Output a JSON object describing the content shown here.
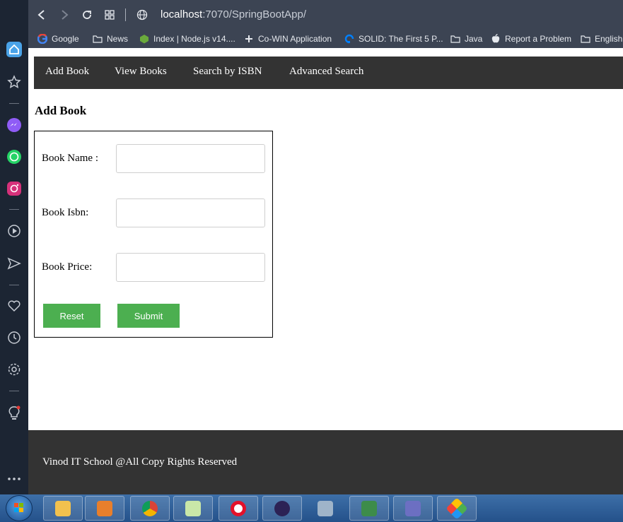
{
  "browser": {
    "url_host": "localhost",
    "url_rest": ":7070/SpringBootApp/",
    "bookmarks": [
      {
        "label": "Google",
        "icon": "google-icon"
      },
      {
        "label": "News",
        "icon": "folder-icon"
      },
      {
        "label": "Index | Node.js v14....",
        "icon": "nodejs-icon"
      },
      {
        "label": "Co-WIN Application",
        "icon": "cowin-icon"
      },
      {
        "label": "SOLID: The First 5 P...",
        "icon": "digitalocean-icon"
      },
      {
        "label": "Java",
        "icon": "folder-icon"
      },
      {
        "label": "Report a Problem",
        "icon": "apple-icon"
      },
      {
        "label": "English",
        "icon": "folder-icon"
      }
    ]
  },
  "nav": {
    "items": [
      {
        "label": "Add Book"
      },
      {
        "label": "View Books"
      },
      {
        "label": "Search by ISBN"
      },
      {
        "label": "Advanced Search"
      }
    ]
  },
  "form": {
    "title": "Add Book",
    "fields": [
      {
        "label": "Book Name :",
        "value": ""
      },
      {
        "label": "Book Isbn:",
        "value": ""
      },
      {
        "label": "Book Price:",
        "value": ""
      }
    ],
    "reset_label": "Reset",
    "submit_label": "Submit"
  },
  "footer": {
    "text": "Vinod IT School @All Copy Rights Reserved"
  },
  "colors": {
    "navbar": "#333333",
    "button": "#4caf50",
    "chrome": "#3c4453",
    "sidebar": "#1c2533"
  }
}
